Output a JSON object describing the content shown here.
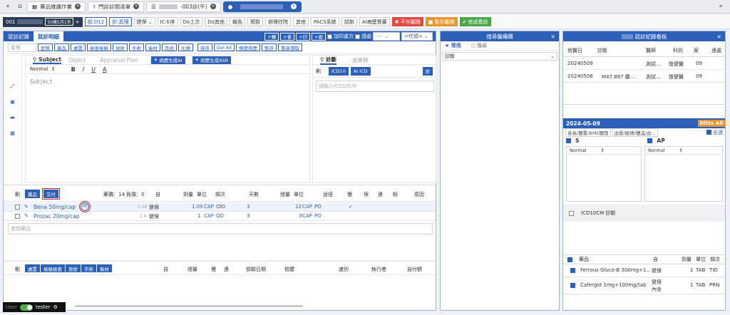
{
  "browser_tabs": [
    {
      "label": "藥品維護作業",
      "icon": "grid-icon"
    },
    {
      "label": "門診診間清單",
      "icon": "stethoscope-icon"
    },
    {
      "label": "-003診(午)",
      "icon": "list-icon"
    },
    {
      "label": "",
      "icon": "user-icon"
    }
  ],
  "toolbar": {
    "patient_id": "001",
    "patient_age": "50歲5月1天",
    "tags": [
      "部:D12",
      "折:具殘"
    ],
    "insurance": "健保",
    "buttons": [
      "IC卡序",
      "Do上次",
      "Do其他",
      "報告",
      "預掛",
      "辦理住院",
      "其他",
      "PACS系統",
      "試辦",
      "AI病歷質審"
    ],
    "no_save_label": "不存離開",
    "temp_save_label": "暫存離開",
    "finish_label": "完成看診"
  },
  "left": {
    "tabs": [
      "就診記錄",
      "就診明細"
    ],
    "tools": [
      "+轉",
      "+會",
      "+印",
      "+被"
    ],
    "checkbox_labels": [
      "加印處方",
      "證處"
    ],
    "select_empty": "----",
    "select_placeholder": "=代領=",
    "search_placeholder": "套餐",
    "category_buttons": [
      "套餐",
      "藥品",
      "處置",
      "檢查檢驗",
      "放射",
      "手術",
      "衛材",
      "其他",
      "化療",
      "排序",
      "Del All",
      "預覽病歷",
      "暫存",
      "重新讀取"
    ],
    "soap_tabs": [
      "Subject",
      "Object",
      "Appraisal Plan"
    ],
    "ai_buttons": [
      "病歷生成AI",
      "病歷生成ASR"
    ],
    "editor_style": "Normal",
    "editor_tools": [
      "B",
      "I",
      "U",
      "A"
    ],
    "editor_placeholder": "Subject",
    "dx_tabs": [
      "診斷",
      "處置碼"
    ],
    "dx_del": "刪",
    "dx_buttons": [
      "ICD10",
      "AI ICD"
    ],
    "dx_common": "常",
    "dx_placeholder": "請輸入ICD10CM",
    "order_header": {
      "del": "刪",
      "btn1": "藥品",
      "btn2": "交付",
      "summary": "藥價：14  負擔：0",
      "cols": [
        "自",
        "劑量",
        "單位",
        "頻次",
        "天數",
        "總量",
        "單位",
        "途徑",
        "慢",
        "保",
        "連",
        "粉",
        "原因"
      ]
    },
    "orders": [
      {
        "name": "Bena 50mg/cap",
        "badge": "同",
        "price": "0.48",
        "ins": "健保",
        "dose": "1.00",
        "unit": "CAP",
        "freq": "QID",
        "days": "3",
        "total": "12",
        "tunit": "CAP",
        "route": "PO",
        "slow": "✓"
      },
      {
        "name": "Prozac 20mg/cap",
        "badge": "",
        "price": "2.8",
        "ins": "健保",
        "dose": "1",
        "unit": "CAP",
        "freq": "QD",
        "days": "3",
        "total": "3",
        "tunit": "CAP",
        "route": "PO",
        "slow": ""
      }
    ],
    "order_search_placeholder": "查詢藥品",
    "bottom_header": {
      "del": "刪",
      "buttons": [
        "處置",
        "檢驗檢查",
        "放射",
        "手術",
        "衛材"
      ],
      "cols": [
        "自",
        "總量",
        "慢",
        "連",
        "檢驗日期",
        "檢體",
        "速別",
        "執行者",
        "自付額"
      ]
    }
  },
  "middle": {
    "title": "搜尋醫囑欄",
    "tabs": [
      "常用",
      "搜尋"
    ],
    "category": "診斷"
  },
  "right": {
    "title": "就診紀錄看板",
    "cols": [
      "就醫日",
      "診斷",
      "醫師",
      "科別",
      "案",
      "連處"
    ],
    "rows": [
      {
        "date": "20240509",
        "dx": "",
        "doctor": "測試...",
        "dept": "復健醫",
        "case": "09"
      },
      {
        "date": "20240508",
        "dx": "M47.897 腰...",
        "doctor": "測試...",
        "dept": "復健醫",
        "case": "09"
      }
    ],
    "detail_date": "2024-05-09",
    "ditto_label": "Ditto All",
    "select_all": "全選",
    "vitals": "身高/體重/BMI/腰圍",
    "vitals2": "血壓/脈搏/體溫/血...",
    "s_label": "S",
    "ap_label": "AP",
    "normal": "Normal",
    "icd_label": "ICD10CM 診斷",
    "med_header": {
      "name": "藥品",
      "self": "自",
      "dose": "劑量",
      "unit": "單位",
      "freq": "頻次"
    },
    "meds": [
      {
        "name": "Ferrous Gluco-B 300mg+1...",
        "ins": "健保",
        "dose": "1",
        "unit": "TAB",
        "freq": "TID"
      },
      {
        "name": "Cafergot 1mg+100mg/tab",
        "ins": "健保 內含",
        "dose": "1",
        "unit": "TAB",
        "freq": "PRN"
      }
    ]
  },
  "status": {
    "user_label": "User",
    "user_name": "tester"
  },
  "colors": {
    "primary": "#2b5fb8",
    "danger": "#e04a3f",
    "warning": "#e8962b",
    "success": "#4aa84a"
  }
}
